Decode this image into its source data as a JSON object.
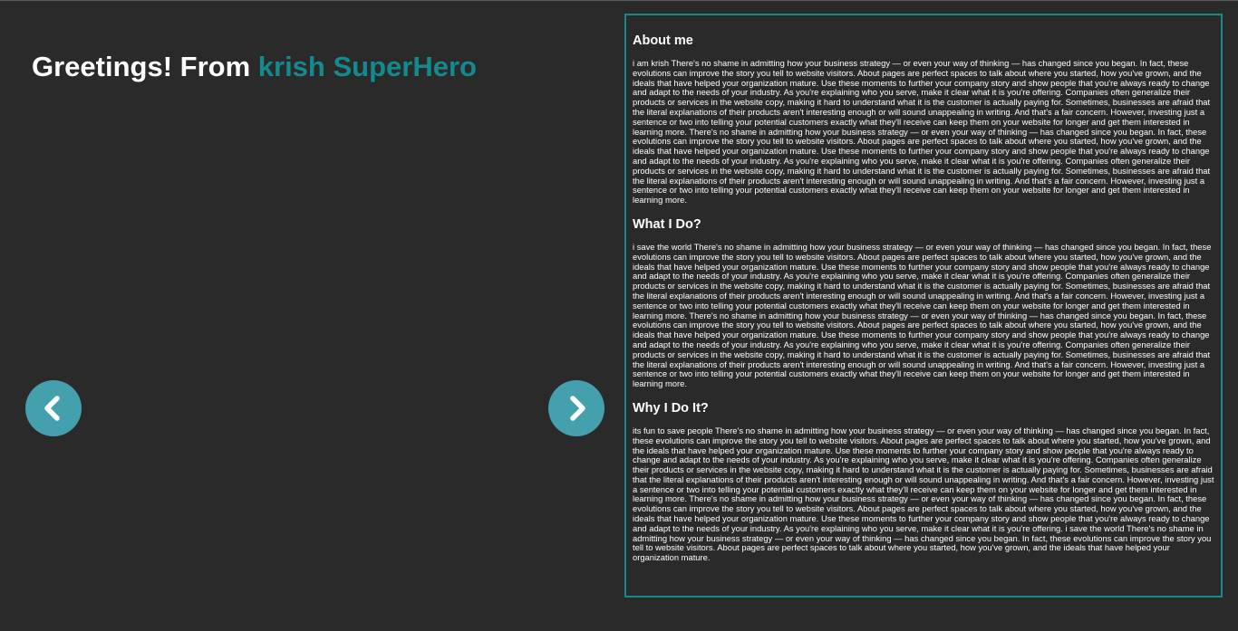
{
  "header": {
    "greeting_prefix": "Greetings! From ",
    "name": "krish SuperHero"
  },
  "carousel": {
    "prev_icon": "chevron-left-icon",
    "next_icon": "chevron-right-icon"
  },
  "colors": {
    "background": "#2a2a2a",
    "accent": "#148a8f",
    "button": "#45a0ae",
    "text": "#ffffff"
  },
  "sections": [
    {
      "heading": "About me",
      "body": "i am krish There's no shame in admitting how your business strategy — or even your way of thinking — has changed since you began. In fact, these evolutions can improve the story you tell to website visitors. About pages are perfect spaces to talk about where you started, how you've grown, and the ideals that have helped your organization mature. Use these moments to further your company story and show people that you're always ready to change and adapt to the needs of your industry. As you're explaining who you serve, make it clear what it is you're offering. Companies often generalize their products or services in the website copy, making it hard to understand what it is the customer is actually paying for. Sometimes, businesses are afraid that the literal explanations of their products aren't interesting enough or will sound unappealing in writing. And that's a fair concern. However, investing just a sentence or two into telling your potential customers exactly what they'll receive can keep them on your website for longer and get them interested in learning more. There's no shame in admitting how your business strategy — or even your way of thinking — has changed since you began. In fact, these evolutions can improve the story you tell to website visitors. About pages are perfect spaces to talk about where you started, how you've grown, and the ideals that have helped your organization mature. Use these moments to further your company story and show people that you're always ready to change and adapt to the needs of your industry. As you're explaining who you serve, make it clear what it is you're offering. Companies often generalize their products or services in the website copy, making it hard to understand what it is the customer is actually paying for. Sometimes, businesses are afraid that the literal explanations of their products aren't interesting enough or will sound unappealing in writing. And that's a fair concern. However, investing just a sentence or two into telling your potential customers exactly what they'll receive can keep them on your website for longer and get them interested in learning more."
    },
    {
      "heading": "What I Do?",
      "body": "i save the world There's no shame in admitting how your business strategy — or even your way of thinking — has changed since you began. In fact, these evolutions can improve the story you tell to website visitors. About pages are perfect spaces to talk about where you started, how you've grown, and the ideals that have helped your organization mature. Use these moments to further your company story and show people that you're always ready to change and adapt to the needs of your industry. As you're explaining who you serve, make it clear what it is you're offering. Companies often generalize their products or services in the website copy, making it hard to understand what it is the customer is actually paying for. Sometimes, businesses are afraid that the literal explanations of their products aren't interesting enough or will sound unappealing in writing. And that's a fair concern. However, investing just a sentence or two into telling your potential customers exactly what they'll receive can keep them on your website for longer and get them interested in learning more. There's no shame in admitting how your business strategy — or even your way of thinking — has changed since you began. In fact, these evolutions can improve the story you tell to website visitors. About pages are perfect spaces to talk about where you started, how you've grown, and the ideals that have helped your organization mature. Use these moments to further your company story and show people that you're always ready to change and adapt to the needs of your industry. As you're explaining who you serve, make it clear what it is you're offering. Companies often generalize their products or services in the website copy, making it hard to understand what it is the customer is actually paying for. Sometimes, businesses are afraid that the literal explanations of their products aren't interesting enough or will sound unappealing in writing. And that's a fair concern. However, investing just a sentence or two into telling your potential customers exactly what they'll receive can keep them on your website for longer and get them interested in learning more."
    },
    {
      "heading": "Why I Do It?",
      "body": "its fun to save people There's no shame in admitting how your business strategy — or even your way of thinking — has changed since you began. In fact, these evolutions can improve the story you tell to website visitors. About pages are perfect spaces to talk about where you started, how you've grown, and the ideals that have helped your organization mature. Use these moments to further your company story and show people that you're always ready to change and adapt to the needs of your industry. As you're explaining who you serve, make it clear what it is you're offering. Companies often generalize their products or services in the website copy, making it hard to understand what it is the customer is actually paying for. Sometimes, businesses are afraid that the literal explanations of their products aren't interesting enough or will sound unappealing in writing. And that's a fair concern. However, investing just a sentence or two into telling your potential customers exactly what they'll receive can keep them on your website for longer and get them interested in learning more. There's no shame in admitting how your business strategy — or even your way of thinking — has changed since you began. In fact, these evolutions can improve the story you tell to website visitors. About pages are perfect spaces to talk about where you started, how you've grown, and the ideals that have helped your organization mature. Use these moments to further your company story and show people that you're always ready to change and adapt to the needs of your industry. As you're explaining who you serve, make it clear what it is you're offering. i save the world There's no shame in admitting how your business strategy — or even your way of thinking — has changed since you began. In fact, these evolutions can improve the story you tell to website visitors. About pages are perfect spaces to talk about where you started, how you've grown, and the ideals that have helped your organization mature."
    }
  ]
}
